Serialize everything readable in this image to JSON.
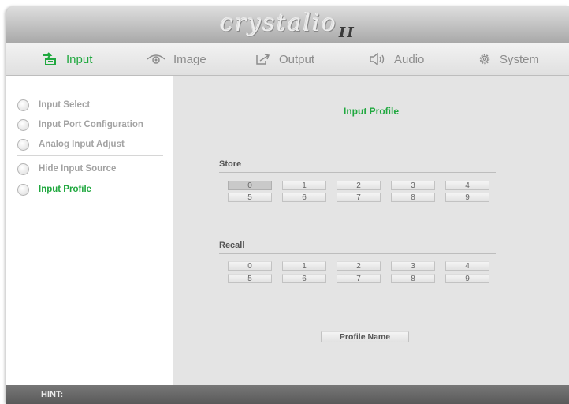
{
  "brand": {
    "name": "crystalio",
    "suffix": "II"
  },
  "tabs": [
    {
      "label": "Input",
      "icon": "input-arrow-icon",
      "active": true
    },
    {
      "label": "Image",
      "icon": "eye-icon",
      "active": false
    },
    {
      "label": "Output",
      "icon": "output-arrow-icon",
      "active": false
    },
    {
      "label": "Audio",
      "icon": "speaker-icon",
      "active": false
    },
    {
      "label": "System",
      "icon": "gear-icon",
      "active": false
    }
  ],
  "sidebar": {
    "items": [
      {
        "label": "Input Select",
        "active": false
      },
      {
        "label": "Input Port Configuration",
        "active": false
      },
      {
        "label": "Analog Input Adjust",
        "active": false
      },
      {
        "label": "Hide Input Source",
        "active": false
      },
      {
        "label": "Input Profile",
        "active": true
      }
    ]
  },
  "main": {
    "title": "Input Profile",
    "store": {
      "label": "Store",
      "buttons": [
        "0",
        "1",
        "2",
        "3",
        "4",
        "5",
        "6",
        "7",
        "8",
        "9"
      ],
      "selected": "0"
    },
    "recall": {
      "label": "Recall",
      "buttons": [
        "0",
        "1",
        "2",
        "3",
        "4",
        "5",
        "6",
        "7",
        "8",
        "9"
      ]
    },
    "profile_name_button": "Profile Name"
  },
  "hint": {
    "label": "HINT:"
  },
  "colors": {
    "accent": "#20a83f",
    "hint_bar": "#666666",
    "content_bg": "#e4e4e4"
  }
}
